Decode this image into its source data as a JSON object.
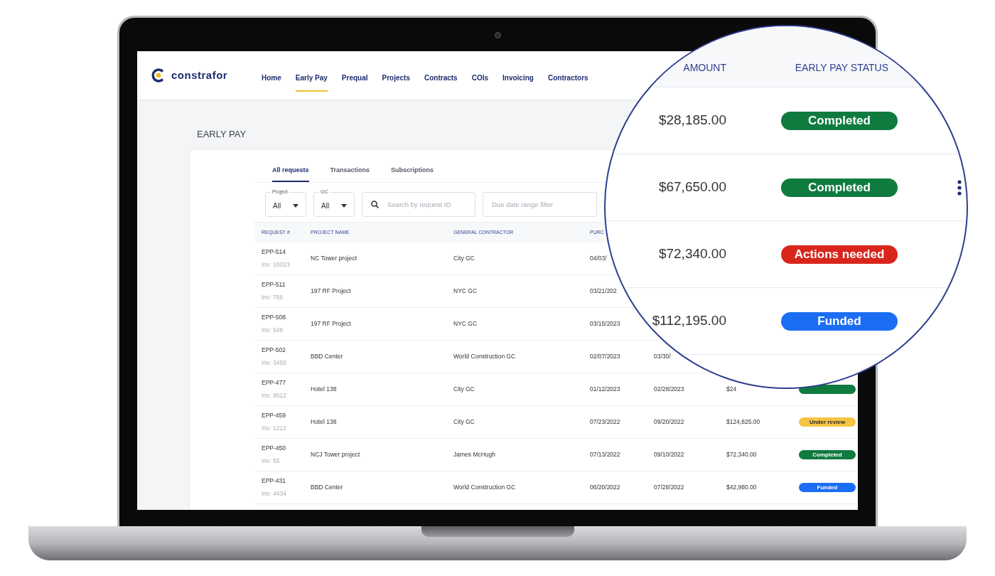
{
  "brand": {
    "name": "constrafor"
  },
  "nav": [
    {
      "label": "Home",
      "selected": false
    },
    {
      "label": "Early Pay",
      "selected": true
    },
    {
      "label": "Prequal",
      "selected": false
    },
    {
      "label": "Projects",
      "selected": false
    },
    {
      "label": "Contracts",
      "selected": false
    },
    {
      "label": "COIs",
      "selected": false
    },
    {
      "label": "Invoicing",
      "selected": false
    },
    {
      "label": "Contractors",
      "selected": false
    }
  ],
  "page_title": "EARLY PAY",
  "tabs": [
    {
      "label": "All requests",
      "selected": true
    },
    {
      "label": "Transactions",
      "selected": false
    },
    {
      "label": "Subscriptions",
      "selected": false
    }
  ],
  "filters": {
    "project": {
      "label": "Project",
      "value": "All"
    },
    "gc": {
      "label": "GC",
      "value": "All"
    },
    "search": {
      "placeholder": "Search by request ID"
    },
    "due_date": {
      "placeholder": "Due date range filter"
    }
  },
  "table": {
    "columns": [
      "REQUEST #",
      "PROJECT NAME",
      "GENERAL CONTRACTOR",
      "PURC"
    ],
    "rows": [
      {
        "request": "EPP-514",
        "invoice": "Inv: 10023",
        "project": "NC Tower project",
        "gc": "City GC",
        "purchase": "04/03/"
      },
      {
        "request": "EPP-511",
        "invoice": "Inv: 766",
        "project": "197 RF Project",
        "gc": "NYC GC",
        "purchase": "03/21/202"
      },
      {
        "request": "EPP-508",
        "invoice": "Inv: 546",
        "project": "197 RF Project",
        "gc": "NYC GC",
        "purchase": "03/15/2023"
      },
      {
        "request": "EPP-502",
        "invoice": "Inv: 3455",
        "project": "BBD Center",
        "gc": "World Construction GC",
        "purchase": "02/07/2023",
        "due": "03/30/"
      },
      {
        "request": "EPP-477",
        "invoice": "Inv: 9512",
        "project": "Hotel 138",
        "gc": "City GC",
        "purchase": "01/12/2023",
        "due": "02/28/2023",
        "amount": "$24",
        "status": {
          "kind": "completed"
        }
      },
      {
        "request": "EPP-459",
        "invoice": "Inv: 1212",
        "project": "Hotel 138",
        "gc": "City GC",
        "purchase": "07/23/2022",
        "due": "09/20/2022",
        "amount": "$124,825.00",
        "status": {
          "kind": "review",
          "label": "Under review"
        }
      },
      {
        "request": "EPP-450",
        "invoice": "Inv: 55",
        "project": "NCJ Tower project",
        "gc": "James McHugh",
        "purchase": "07/13/2022",
        "due": "09/10/2022",
        "amount": "$72,340.00",
        "status": {
          "kind": "completed",
          "label": "Completed"
        }
      },
      {
        "request": "EPP-431",
        "invoice": "Inv: 4434",
        "project": "BBD Center",
        "gc": "World Construction GC",
        "purchase": "06/20/2022",
        "due": "07/28/2022",
        "amount": "$42,980.00",
        "status": {
          "kind": "funded",
          "label": "Funded"
        }
      }
    ]
  },
  "magnifier": {
    "columns": [
      "AMOUNT",
      "EARLY PAY STATUS"
    ],
    "rows": [
      {
        "amount": "$28,185.00",
        "status": {
          "kind": "completed",
          "label": "Completed"
        }
      },
      {
        "amount": "$67,650.00",
        "status": {
          "kind": "completed",
          "label": "Completed"
        },
        "menu": true
      },
      {
        "amount": "$72,340.00",
        "status": {
          "kind": "alert",
          "label": "Actions needed"
        },
        "menu": false
      },
      {
        "amount": "$112,195.00",
        "status": {
          "kind": "funded",
          "label": "Funded"
        }
      }
    ]
  }
}
